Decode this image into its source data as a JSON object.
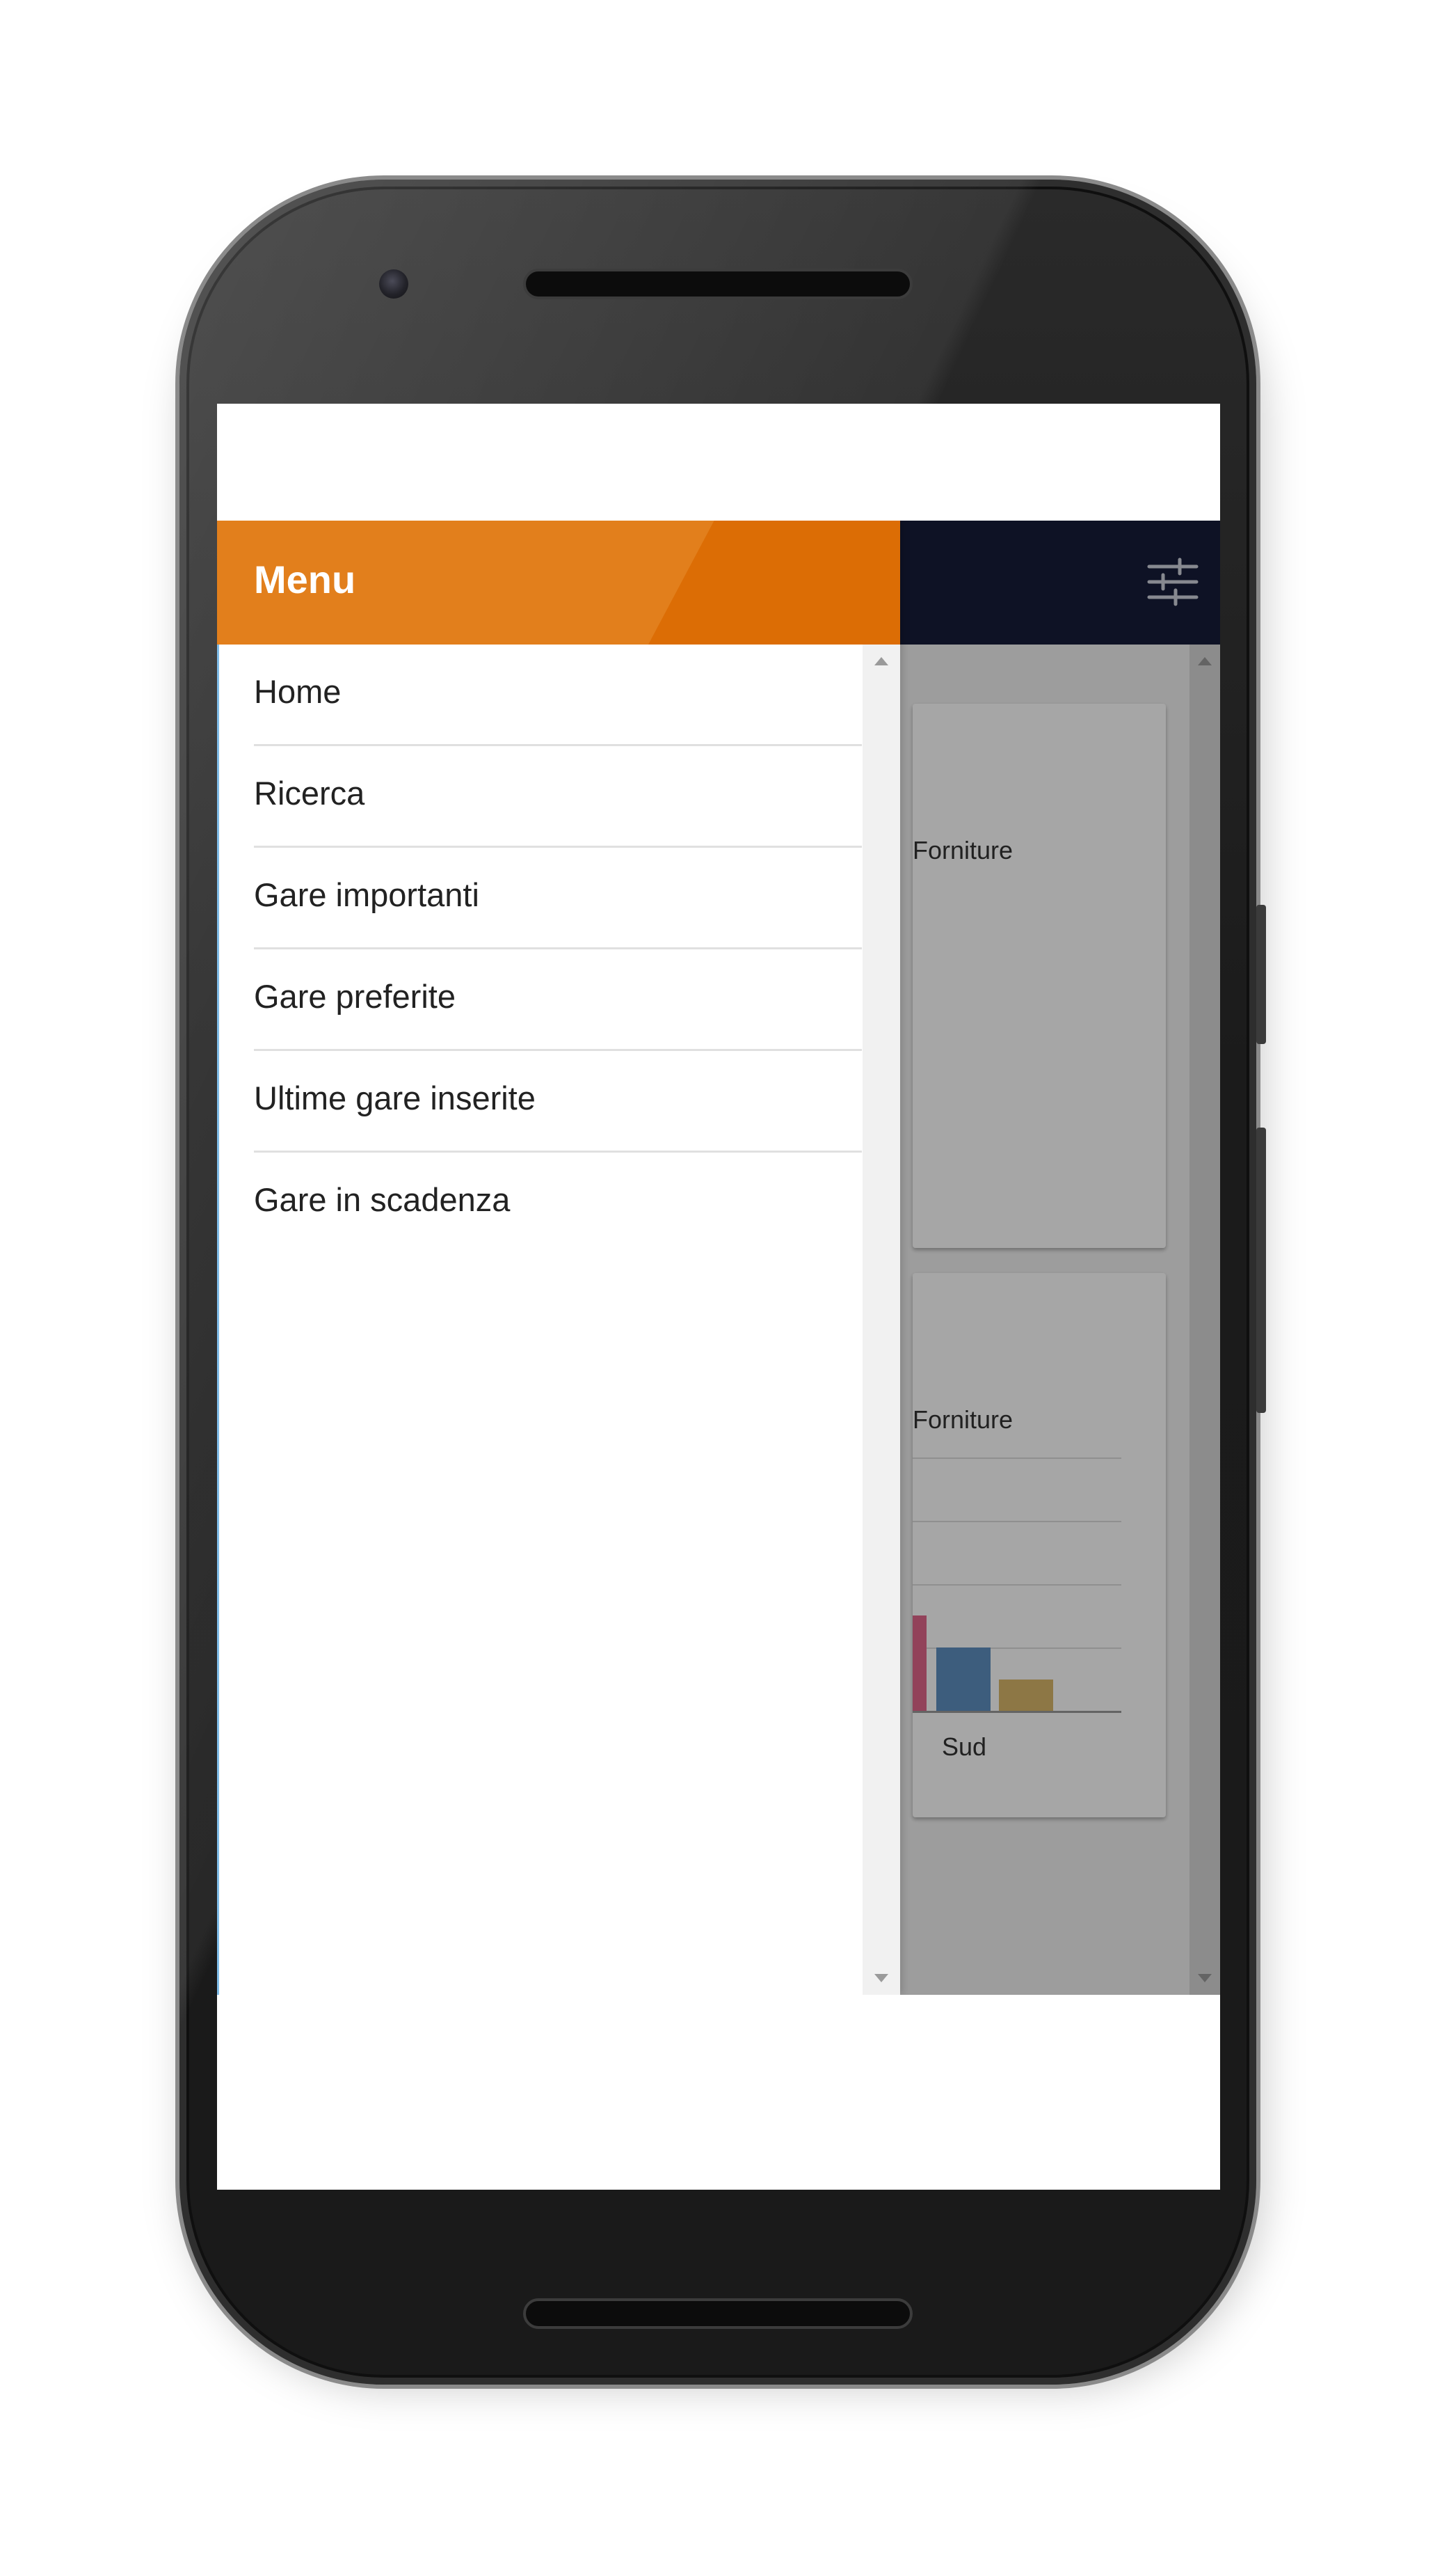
{
  "drawer": {
    "title": "Menu",
    "header_color": "#e27f1c",
    "items": [
      {
        "label": "Home"
      },
      {
        "label": "Ricerca"
      },
      {
        "label": "Gare importanti"
      },
      {
        "label": "Gare preferite"
      },
      {
        "label": "Ultime gare inserite"
      },
      {
        "label": "Gare in scadenza"
      }
    ]
  },
  "toolbar": {
    "color": "#161d39",
    "filter_icon": "sliders-icon"
  },
  "cards": [
    {
      "partial_label": "Forniture"
    },
    {
      "partial_label": "Forniture",
      "chart_x_label": "Sud"
    }
  ]
}
